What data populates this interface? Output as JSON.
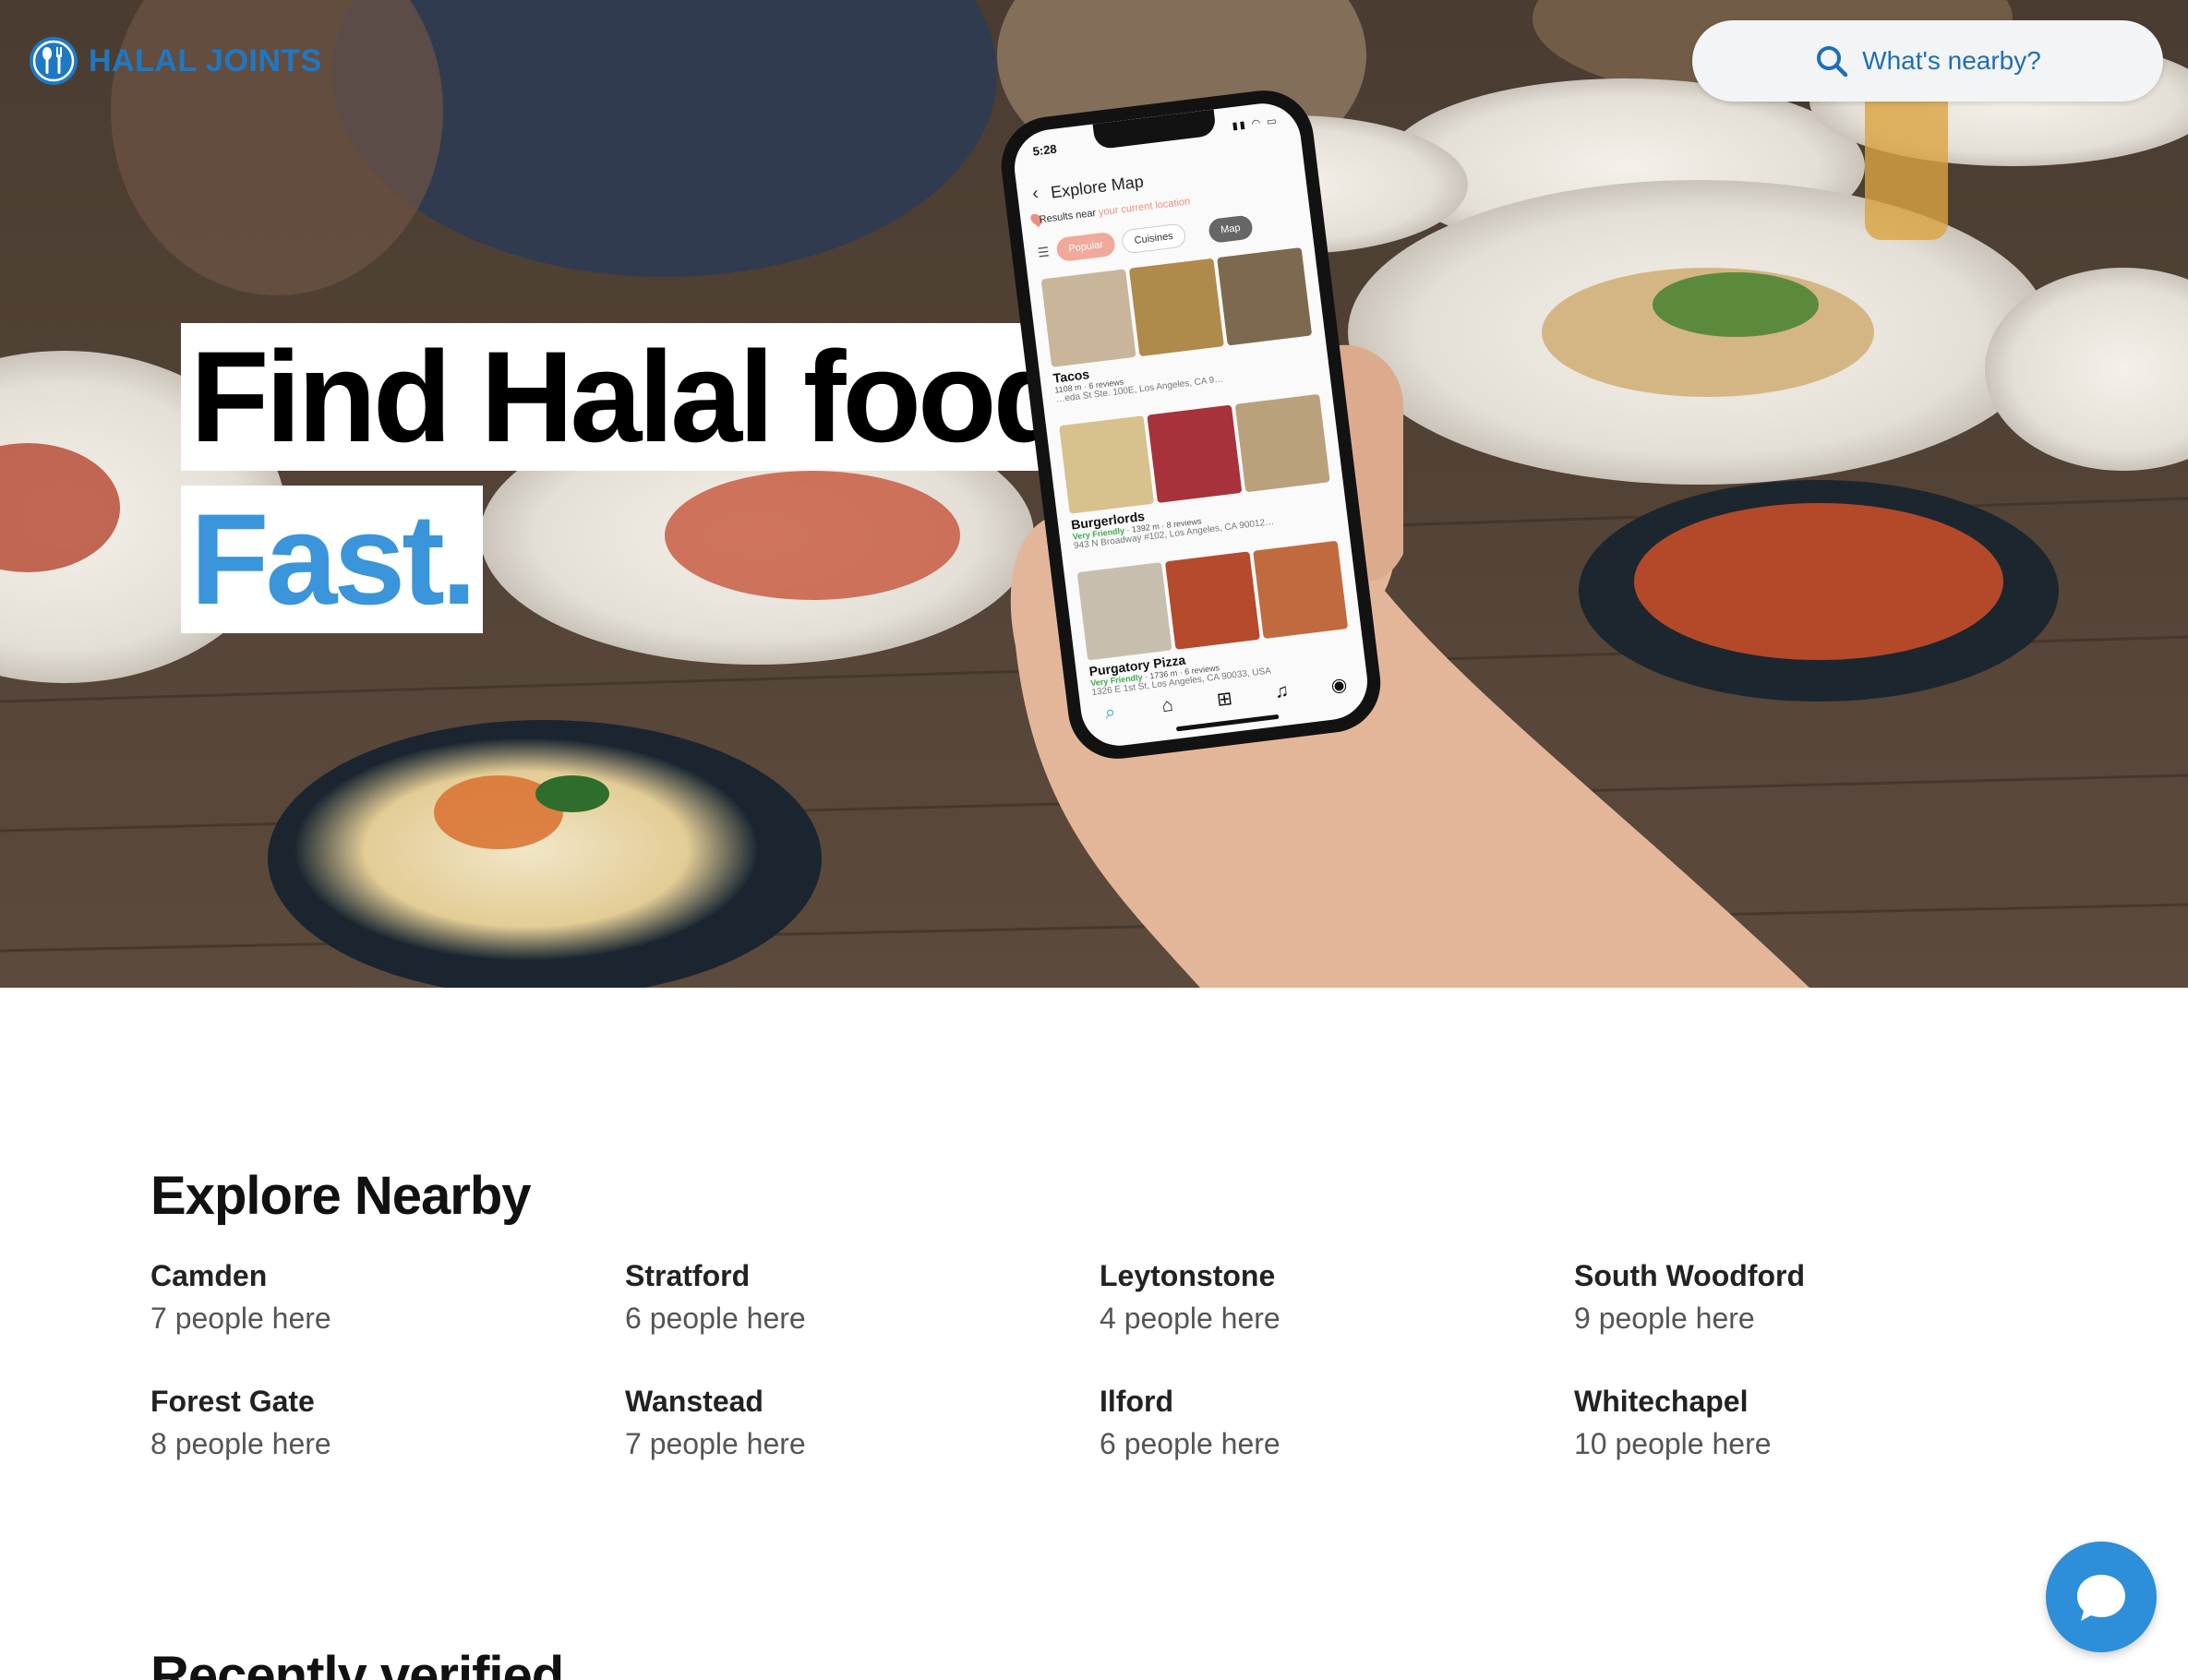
{
  "brand": {
    "name": "HALAL JOINTS",
    "accent": "#1e78c4"
  },
  "search": {
    "label": "What's nearby?",
    "icon": "search-icon"
  },
  "hero": {
    "line1": "Find Halal food.",
    "line2": "Fast.",
    "line2_color": "#3a95da"
  },
  "phone": {
    "time": "5:28",
    "title": "Explore Map",
    "results_prefix": "Results near",
    "results_location": "your current location",
    "chips": [
      "Popular",
      "Cuisines",
      "Map"
    ],
    "listings": [
      {
        "name": "Tacos",
        "meta": "1108 m · 6 reviews",
        "address": "…eda St Ste. 100E, Los Angeles, CA 9…",
        "friendly": ""
      },
      {
        "name": "Burgerlords",
        "friendly": "Very Friendly",
        "meta": " · 1392 m · 8 reviews",
        "address": "943 N Broadway #102, Los Angeles, CA 90012…"
      },
      {
        "name": "Purgatory Pizza",
        "friendly": "Very Friendly",
        "meta": " · 1736 m · 6 reviews",
        "address": "1326 E 1st St, Los Angeles, CA 90033, USA"
      }
    ],
    "tabs": [
      "search-icon",
      "home-icon",
      "add-icon",
      "bell-icon",
      "profile-icon"
    ]
  },
  "explore": {
    "title": "Explore Nearby",
    "places": [
      {
        "name": "Camden",
        "count": "7 people here"
      },
      {
        "name": "Stratford",
        "count": "6 people here"
      },
      {
        "name": "Leytonstone",
        "count": "4 people here"
      },
      {
        "name": "South Woodford",
        "count": "9 people here"
      },
      {
        "name": "Forest Gate",
        "count": "8 people here"
      },
      {
        "name": "Wanstead",
        "count": "7 people here"
      },
      {
        "name": "Ilford",
        "count": "6 people here"
      },
      {
        "name": "Whitechapel",
        "count": "10 people here"
      }
    ]
  },
  "recent": {
    "title": "Recently verified"
  },
  "chat": {
    "icon": "chat-icon",
    "color": "#2d8ed9"
  }
}
